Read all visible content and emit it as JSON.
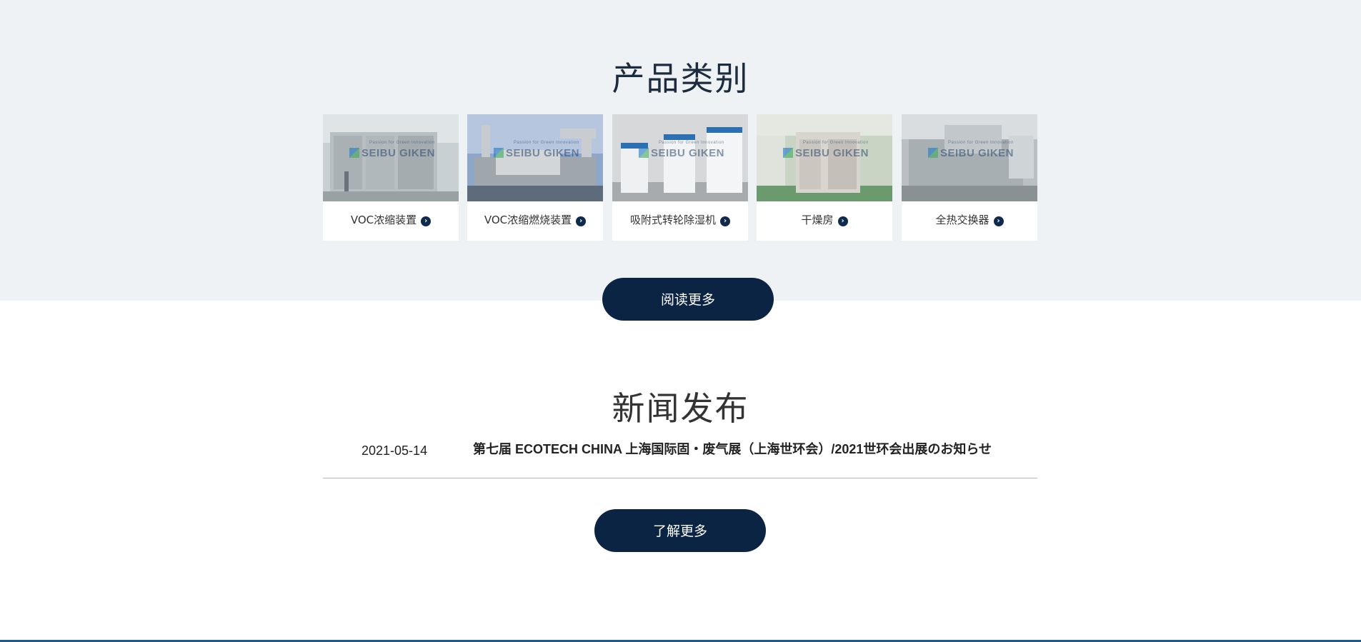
{
  "products": {
    "title": "产品类别",
    "logo_text": "SEIBU GIKEN",
    "logo_tagline": "Passion for Green Innovation",
    "cards": [
      {
        "label": "VOC浓缩装置",
        "icon": "chevron-right-circle-icon"
      },
      {
        "label": "VOC浓缩燃烧装置",
        "icon": "chevron-right-circle-icon"
      },
      {
        "label": "吸附式转轮除湿机",
        "icon": "chevron-right-circle-icon"
      },
      {
        "label": "干燥房",
        "icon": "chevron-right-circle-icon"
      },
      {
        "label": "全热交换器",
        "icon": "chevron-right-circle-icon"
      }
    ],
    "read_more": "阅读更多"
  },
  "news": {
    "title": "新闻发布",
    "items": [
      {
        "date": "2021-05-14",
        "title": "第七届 ECOTECH CHINA 上海国际固・废气展（上海世环会）/2021世环会出展のお知らせ"
      }
    ],
    "learn_more": "了解更多"
  },
  "colors": {
    "section_bg": "#eef2f5",
    "button_bg": "#0c2444",
    "accent": "#0f2a4d"
  }
}
